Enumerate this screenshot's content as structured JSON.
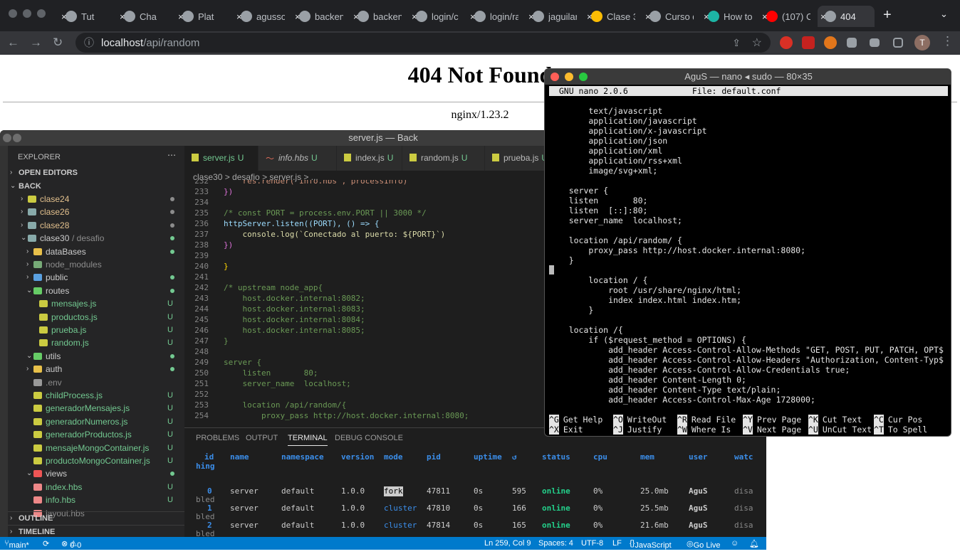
{
  "browser": {
    "tabs": [
      {
        "label": "Tut"
      },
      {
        "label": "Cha"
      },
      {
        "label": "Plat"
      },
      {
        "label": "agusso"
      },
      {
        "label": "backen"
      },
      {
        "label": "backen"
      },
      {
        "label": "login/c"
      },
      {
        "label": "login/ra"
      },
      {
        "label": "jaguilar"
      },
      {
        "label": "Clase 3"
      },
      {
        "label": "Curso d"
      },
      {
        "label": "How to"
      },
      {
        "label": "(107) C"
      },
      {
        "label": "404"
      }
    ],
    "url_host": "localhost",
    "url_path": "/api/random",
    "profile": "T"
  },
  "page": {
    "heading": "404 Not Found",
    "server": "nginx/1.23.2"
  },
  "vscode": {
    "title": "server.js — Back",
    "explorer_label": "EXPLORER",
    "open_editors": "OPEN EDITORS",
    "root": "BACK",
    "tree": [
      {
        "name": "clase24",
        "status": "dot"
      },
      {
        "name": "clase26",
        "status": "dot"
      },
      {
        "name": "clase28",
        "status": "dot"
      },
      {
        "name": "clase30",
        "sub": "/ desafio",
        "status": "dot"
      },
      {
        "name": "dataBases",
        "status": "dot"
      },
      {
        "name": "node_modules",
        "status": ""
      },
      {
        "name": "public",
        "status": "dot"
      },
      {
        "name": "routes",
        "status": "dot"
      },
      {
        "name": "mensajes.js",
        "status": "U"
      },
      {
        "name": "productos.js",
        "status": "U"
      },
      {
        "name": "prueba.js",
        "status": "U"
      },
      {
        "name": "random.js",
        "status": "U"
      },
      {
        "name": "utils",
        "status": "dot"
      },
      {
        "name": "auth",
        "status": "dot"
      },
      {
        "name": ".env",
        "status": ""
      },
      {
        "name": "childProcess.js",
        "status": "U"
      },
      {
        "name": "generadorMensajes.js",
        "status": "U"
      },
      {
        "name": "generadorNumeros.js",
        "status": "U"
      },
      {
        "name": "generadorProductos.js",
        "status": "U"
      },
      {
        "name": "mensajeMongoContainer.js",
        "status": "U"
      },
      {
        "name": "productoMongoContainer.js",
        "status": "U"
      },
      {
        "name": "views",
        "status": "dot"
      },
      {
        "name": "index.hbs",
        "status": "U"
      },
      {
        "name": "info.hbs",
        "status": "U"
      },
      {
        "name": "layout.hbs",
        "status": ""
      }
    ],
    "outline": "OUTLINE",
    "timeline": "TIMELINE",
    "tabs": [
      {
        "label": "server.js",
        "u": "U"
      },
      {
        "label": "info.hbs",
        "u": "U"
      },
      {
        "label": "index.js",
        "u": "U"
      },
      {
        "label": "random.js",
        "u": "U"
      },
      {
        "label": "prueba.js",
        "u": "U"
      }
    ],
    "breadcrumb": "clase30 > desafio > server.js > ...",
    "code": [
      {
        "n": "232",
        "t": "    res.render('info.hbs', processInfo)"
      },
      {
        "n": "233",
        "t": "})"
      },
      {
        "n": "234",
        "t": ""
      },
      {
        "n": "235",
        "t": "/* const PORT = process.env.PORT || 3000 */"
      },
      {
        "n": "236",
        "t": "httpServer.listen((PORT), () => {"
      },
      {
        "n": "237",
        "t": "    console.log(`Conectado al puerto: ${PORT}`)"
      },
      {
        "n": "238",
        "t": "})"
      },
      {
        "n": "239",
        "t": ""
      },
      {
        "n": "240",
        "t": "}"
      },
      {
        "n": "241",
        "t": ""
      },
      {
        "n": "242",
        "t": "/* upstream node_app{"
      },
      {
        "n": "243",
        "t": "    host.docker.internal:8082;"
      },
      {
        "n": "244",
        "t": "    host.docker.internal:8083;"
      },
      {
        "n": "245",
        "t": "    host.docker.internal:8084;"
      },
      {
        "n": "246",
        "t": "    host.docker.internal:8085;"
      },
      {
        "n": "247",
        "t": "}"
      },
      {
        "n": "248",
        "t": ""
      },
      {
        "n": "249",
        "t": "server {"
      },
      {
        "n": "250",
        "t": "    listen       80;"
      },
      {
        "n": "251",
        "t": "    server_name  localhost;"
      },
      {
        "n": "252",
        "t": ""
      },
      {
        "n": "253",
        "t": "    location /api/random/{"
      },
      {
        "n": "254",
        "t": "        proxy_pass http://host.docker.internal:8080;"
      }
    ],
    "panel_tabs": [
      "PROBLEMS",
      "OUTPUT",
      "TERMINAL",
      "DEBUG CONSOLE"
    ],
    "pm2_headers": [
      "id",
      "name",
      "namespace",
      "version",
      "mode",
      "pid",
      "uptime",
      "↺",
      "status",
      "cpu",
      "mem",
      "user",
      "watc"
    ],
    "pm2_header_wrap": "hing",
    "pm2_rows": [
      {
        "id": "0",
        "name": "server",
        "namespace": "default",
        "version": "1.0.0",
        "mode": "fork",
        "pid": "47811",
        "uptime": "0s",
        "restarts": "595",
        "status": "online",
        "cpu": "0%",
        "mem": "25.0mb",
        "user": "AguS",
        "watch": "disa",
        "wrap": "bled"
      },
      {
        "id": "1",
        "name": "server",
        "namespace": "default",
        "version": "1.0.0",
        "mode": "cluster",
        "pid": "47810",
        "uptime": "0s",
        "restarts": "166",
        "status": "online",
        "cpu": "0%",
        "mem": "25.5mb",
        "user": "AguS",
        "watch": "disa",
        "wrap": "bled"
      },
      {
        "id": "2",
        "name": "server",
        "namespace": "default",
        "version": "1.0.0",
        "mode": "cluster",
        "pid": "47814",
        "uptime": "0s",
        "restarts": "165",
        "status": "online",
        "cpu": "0%",
        "mem": "21.6mb",
        "user": "AguS",
        "watch": "disa",
        "wrap": "bled"
      }
    ],
    "status": {
      "branch": "main*",
      "errors": "0",
      "warnings": "0",
      "position": "Ln 259, Col 9",
      "spaces": "Spaces: 4",
      "encoding": "UTF-8",
      "eol": "LF",
      "language": "JavaScript",
      "golive": "Go Live"
    }
  },
  "terminal": {
    "title": "AguS — nano ◂ sudo — 80×35",
    "nano_version": "GNU nano 2.0.6",
    "file": "File: default.conf",
    "lines": [
      "        text/javascript",
      "        application/javascript",
      "        application/x-javascript",
      "        application/json",
      "        application/xml",
      "        application/rss+xml",
      "        image/svg+xml;",
      "",
      "    server {",
      "    listen       80;",
      "    listen  [::]:80;",
      "    server_name  localhost;",
      "",
      "    location /api/random/ {",
      "        proxy_pass http://host.docker.internal:8080;",
      "    }",
      "",
      "        location / {",
      "            root /usr/share/nginx/html;",
      "            index index.html index.htm;",
      "        }",
      "",
      "    location /{",
      "        if ($request_method = OPTIONS) {",
      "            add_header Access-Control-Allow-Methods \"GET, POST, PUT, PATCH, OPT$",
      "            add_header Access-Control-Allow-Headers \"Authorization, Content-Typ$",
      "            add_header Access-Control-Allow-Credentials true;",
      "            add_header Content-Length 0;",
      "            add_header Content-Type text/plain;",
      "            add_header Access-Control-Max-Age 1728000;"
    ],
    "shortcuts": [
      {
        "k": "^G",
        "l": "Get Help"
      },
      {
        "k": "^O",
        "l": "WriteOut"
      },
      {
        "k": "^R",
        "l": "Read File"
      },
      {
        "k": "^Y",
        "l": "Prev Page"
      },
      {
        "k": "^K",
        "l": "Cut Text"
      },
      {
        "k": "^C",
        "l": "Cur Pos"
      },
      {
        "k": "^X",
        "l": "Exit"
      },
      {
        "k": "^J",
        "l": "Justify"
      },
      {
        "k": "^W",
        "l": "Where Is"
      },
      {
        "k": "^V",
        "l": "Next Page"
      },
      {
        "k": "^U",
        "l": "UnCut Text"
      },
      {
        "k": "^T",
        "l": "To Spell"
      }
    ]
  }
}
